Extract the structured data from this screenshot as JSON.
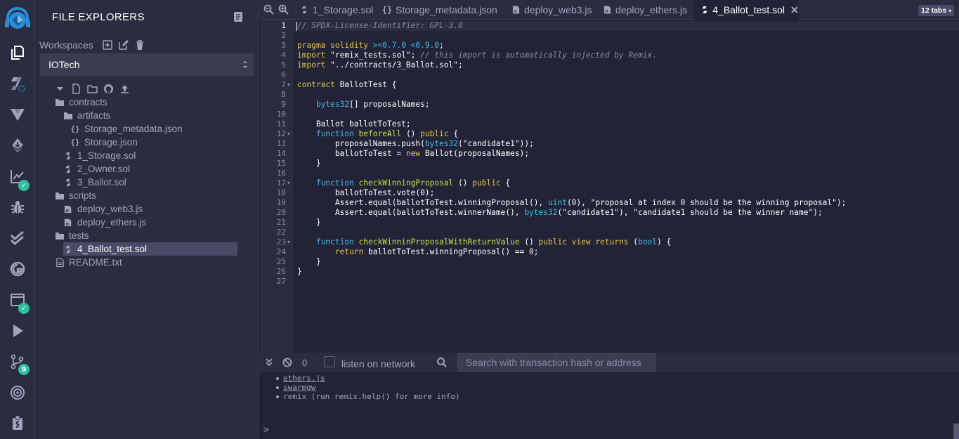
{
  "icon_bar": {
    "items": [
      {
        "name": "remix-logo-icon"
      },
      {
        "name": "file-explorer-icon"
      },
      {
        "name": "solidity-compiler-icon"
      },
      {
        "name": "vyper-icon"
      },
      {
        "name": "deploy-run-icon"
      },
      {
        "name": "analysis-icon",
        "badge": "✓"
      },
      {
        "name": "debugger-icon"
      },
      {
        "name": "unit-testing-icon"
      },
      {
        "name": "gas-icon"
      },
      {
        "name": "mythx-icon",
        "badge": "✓"
      },
      {
        "name": "run-script-icon"
      },
      {
        "name": "git-icon",
        "badge": "9"
      },
      {
        "name": "plugin-manager-icon"
      },
      {
        "name": "settings-icon"
      }
    ],
    "badge_color": "#2fbfa0"
  },
  "explorer": {
    "title": "FILE EXPLORERS",
    "workspaces_label": "Workspaces",
    "workspace_selected": "IOTech",
    "tree": [
      {
        "label": "contracts",
        "type": "folder",
        "depth": 1
      },
      {
        "label": "artifacts",
        "type": "folder",
        "depth": 2
      },
      {
        "label": "Storage_metadata.json",
        "type": "json",
        "depth": 3
      },
      {
        "label": "Storage.json",
        "type": "json",
        "depth": 3
      },
      {
        "label": "1_Storage.sol",
        "type": "sol",
        "depth": 2
      },
      {
        "label": "2_Owner.sol",
        "type": "sol",
        "depth": 2
      },
      {
        "label": "3_Ballot.sol",
        "type": "sol",
        "depth": 2
      },
      {
        "label": "scripts",
        "type": "folder",
        "depth": 1
      },
      {
        "label": "deploy_web3.js",
        "type": "js",
        "depth": 2
      },
      {
        "label": "deploy_ethers.js",
        "type": "js",
        "depth": 2
      },
      {
        "label": "tests",
        "type": "folder",
        "depth": 1
      },
      {
        "label": "4_Ballot_test.sol",
        "type": "sol",
        "depth": 2,
        "selected": true
      },
      {
        "label": "README.txt",
        "type": "txt",
        "depth": 1
      }
    ]
  },
  "tabs": {
    "items": [
      {
        "label": "1_Storage.sol",
        "icon": "solidity-file-icon"
      },
      {
        "label": "Storage_metadata.json",
        "icon": "json-file-icon"
      },
      {
        "label": "deploy_web3.js",
        "icon": "js-file-icon"
      },
      {
        "label": "deploy_ethers.js",
        "icon": "js-file-icon"
      },
      {
        "label": "4_Ballot_test.sol",
        "icon": "solidity-file-icon",
        "active": true
      }
    ],
    "count_label": "12 tabs"
  },
  "editor": {
    "active_line": 1,
    "line_numbers": [
      "1",
      "2",
      "3",
      "4",
      "5",
      "6",
      "7",
      "8",
      "9",
      "10",
      "11",
      "12",
      "13",
      "14",
      "15",
      "16",
      "17",
      "18",
      "19",
      "20",
      "21",
      "22",
      "23",
      "24",
      "25",
      "26",
      "27"
    ],
    "fold_lines": [
      7,
      12,
      17,
      23
    ],
    "lines": [
      [
        [
          "cm",
          "// SPDX-License-Identifier: GPL-3.0"
        ]
      ],
      [],
      [
        [
          "kw",
          "pragma solidity "
        ],
        [
          "ty",
          ">=0.7.0 <0.9.0"
        ],
        [
          "id",
          ";"
        ]
      ],
      [
        [
          "kw",
          "import "
        ],
        [
          "st",
          "\"remix_tests.sol\""
        ],
        [
          "id",
          "; "
        ],
        [
          "cm",
          "// this import is automatically injected by Remix."
        ]
      ],
      [
        [
          "kw",
          "import "
        ],
        [
          "st",
          "\"../contracts/3_Ballot.sol\""
        ],
        [
          "id",
          ";"
        ]
      ],
      [],
      [
        [
          "kw",
          "contract "
        ],
        [
          "id",
          "BallotTest {"
        ]
      ],
      [],
      [
        [
          "id",
          "    "
        ],
        [
          "ty",
          "bytes32"
        ],
        [
          "id",
          "[] proposalNames;"
        ]
      ],
      [],
      [
        [
          "id",
          "    Ballot ballotToTest;"
        ]
      ],
      [
        [
          "id",
          "    "
        ],
        [
          "ty",
          "function "
        ],
        [
          "fn",
          "beforeAll"
        ],
        [
          "id",
          " () "
        ],
        [
          "kw",
          "public"
        ],
        [
          "id",
          " {"
        ]
      ],
      [
        [
          "id",
          "        proposalNames.push("
        ],
        [
          "ty",
          "bytes32"
        ],
        [
          "id",
          "("
        ],
        [
          "st",
          "\"candidate1\""
        ],
        [
          "id",
          "));"
        ]
      ],
      [
        [
          "id",
          "        ballotToTest = "
        ],
        [
          "kw",
          "new"
        ],
        [
          "id",
          " Ballot(proposalNames);"
        ]
      ],
      [
        [
          "id",
          "    }"
        ]
      ],
      [],
      [
        [
          "id",
          "    "
        ],
        [
          "ty",
          "function "
        ],
        [
          "fn",
          "checkWinningProposal"
        ],
        [
          "id",
          " () "
        ],
        [
          "kw",
          "public"
        ],
        [
          "id",
          " {"
        ]
      ],
      [
        [
          "id",
          "        ballotToTest.vote(0);"
        ]
      ],
      [
        [
          "id",
          "        Assert.equal(ballotToTest.winningProposal(), "
        ],
        [
          "ty",
          "uint"
        ],
        [
          "id",
          "(0), "
        ],
        [
          "st",
          "\"proposal at index 0 should be the winning proposal\""
        ],
        [
          "id",
          ");"
        ]
      ],
      [
        [
          "id",
          "        Assert.equal(ballotToTest.winnerName(), "
        ],
        [
          "ty",
          "bytes32"
        ],
        [
          "id",
          "("
        ],
        [
          "st",
          "\"candidate1\""
        ],
        [
          "id",
          "), "
        ],
        [
          "st",
          "\"candidate1 should be the winner name\""
        ],
        [
          "id",
          ");"
        ]
      ],
      [
        [
          "id",
          "    }"
        ]
      ],
      [],
      [
        [
          "id",
          "    "
        ],
        [
          "ty",
          "function "
        ],
        [
          "fn",
          "checkWinninProposalWithReturnValue"
        ],
        [
          "id",
          " () "
        ],
        [
          "kw",
          "public view returns"
        ],
        [
          "id",
          " ("
        ],
        [
          "ty",
          "bool"
        ],
        [
          "id",
          ") {"
        ]
      ],
      [
        [
          "id",
          "        "
        ],
        [
          "kw",
          "return"
        ],
        [
          "id",
          " ballotToTest.winningProposal() == 0;"
        ]
      ],
      [
        [
          "id",
          "    }"
        ]
      ],
      [
        [
          "id",
          "}"
        ]
      ],
      []
    ]
  },
  "terminal": {
    "tx_count": "0",
    "listen_label": "listen on network",
    "search_placeholder": "Search with transaction hash or address",
    "lines": [
      {
        "text": "ethers.js",
        "link": true
      },
      {
        "text": "swarmgw",
        "link": true
      },
      {
        "text": "remix (run remix.help() for more info)",
        "link": false
      }
    ],
    "prompt": ">"
  }
}
